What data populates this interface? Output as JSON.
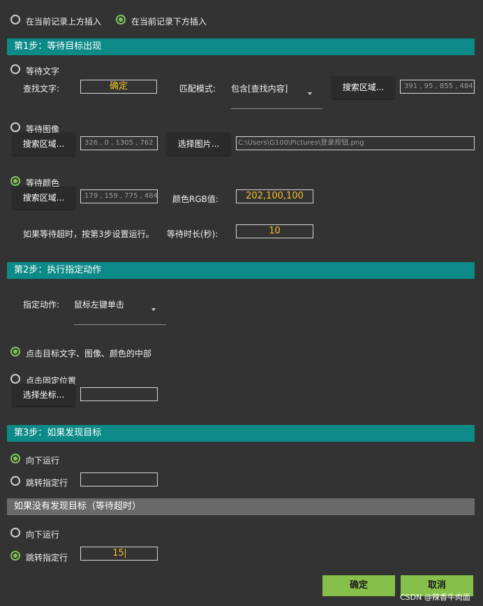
{
  "insert_options": {
    "above": "在当前记录上方插入",
    "below": "在当前记录下方插入"
  },
  "step1": {
    "title": "第1步：等待目标出现",
    "wait_text": {
      "label": "等待文字",
      "find_text_label": "查找文字:",
      "find_text_value": "确定",
      "match_mode_label": "匹配模式:",
      "match_mode_value": "包含[查找内容]",
      "search_area_button": "搜索区域...",
      "search_area_value": "391 , 95 , 855 , 484"
    },
    "wait_image": {
      "label": "等待图像",
      "search_area_button": "搜索区域...",
      "search_area_value": "326 , 0 , 1305 , 762",
      "select_image_button": "选择图片...",
      "image_path": "C:\\Users\\G100\\Pictures\\登录按钮.png"
    },
    "wait_color": {
      "label": "等待颜色",
      "search_area_button": "搜索区域...",
      "search_area_value": "179 , 159 , 775 , 484",
      "rgb_label": "颜色RGB值:",
      "rgb_value": "202,100,100"
    },
    "timeout_note": "如果等待超时，按第3步设置运行。",
    "timeout_label": "等待时长(秒):",
    "timeout_value": "10"
  },
  "step2": {
    "title": "第2步：执行指定动作",
    "action_label": "指定动作:",
    "action_value": "鼠标左键单击",
    "click_center_label": "点击目标文字、图像、颜色的中部",
    "click_fixed_label": "点击固定位置",
    "select_coord_button": "选择坐标...",
    "coord_value": ""
  },
  "step3": {
    "title": "第3步：如果发现目标",
    "run_down_label": "向下运行",
    "jump_label": "跳转指定行",
    "jump_value": ""
  },
  "not_found": {
    "title": "如果没有发现目标（等待超时）",
    "run_down_label": "向下运行",
    "jump_label": "跳转指定行",
    "jump_value": "15"
  },
  "buttons": {
    "ok": "确定",
    "cancel": "取消"
  },
  "watermark": "CSDN @辣香牛肉面",
  "colors": {
    "accent_teal": "#0b8a87",
    "accent_green": "#86c04a",
    "value_yellow": "#f2c12e"
  }
}
